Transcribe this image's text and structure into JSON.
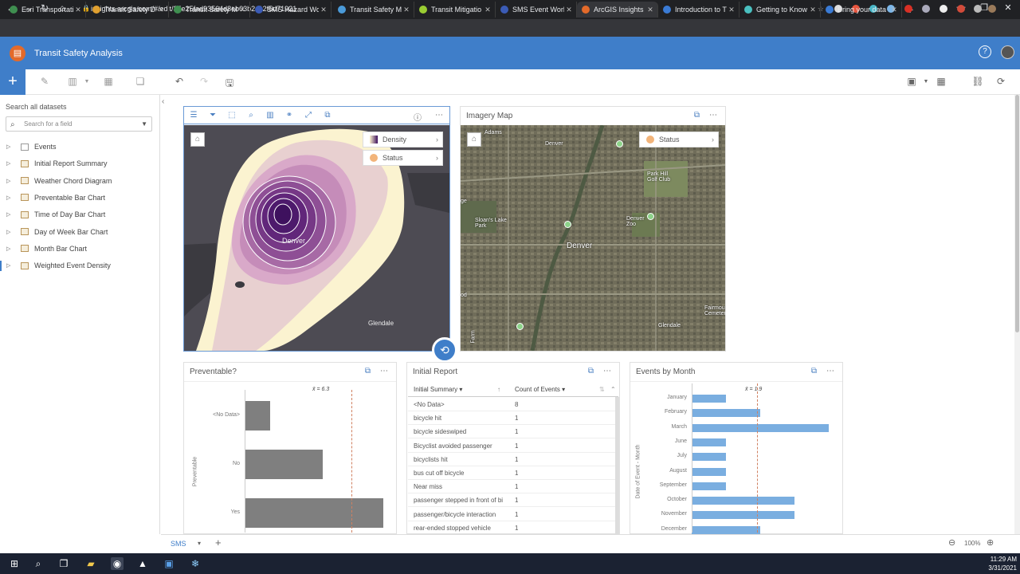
{
  "browser": {
    "tabs": [
      {
        "title": "Esri Transportatio",
        "color": "#3f8f50"
      },
      {
        "title": "Transit Safety Da",
        "color": "#e0a030"
      },
      {
        "title": "Transit Safety Ma",
        "color": "#3f8f50"
      },
      {
        "title": "SMS Hazard Wor",
        "color": "#3b5bb5"
      },
      {
        "title": "Transit Safety Ma",
        "color": "#4a9ad8"
      },
      {
        "title": "Transit Mitigatio",
        "color": "#9acd32"
      },
      {
        "title": "SMS Event Work",
        "color": "#3b5bb5"
      },
      {
        "title": "ArcGIS Insights",
        "color": "#e36a2a"
      },
      {
        "title": "Introduction to T",
        "color": "#3a7bd5"
      },
      {
        "title": "Getting to Know",
        "color": "#4ac0c0"
      },
      {
        "title": "Bring your data",
        "color": "#3a7bd5"
      }
    ],
    "url": "insights.arcgis.com/#/edit/35e25fad93564d8eb03b2c12f5d71921"
  },
  "app": {
    "title": "Transit Safety Analysis"
  },
  "left_panel": {
    "search_label": "Search all datasets",
    "field_placeholder": "Search for a field",
    "datasets": [
      {
        "label": "Events"
      },
      {
        "label": "Initial Report Summary"
      },
      {
        "label": "Weather Chord Diagram"
      },
      {
        "label": "Preventable Bar Chart"
      },
      {
        "label": "Time of Day Bar Chart"
      },
      {
        "label": "Day of Week Bar Chart"
      },
      {
        "label": "Month Bar Chart"
      },
      {
        "label": "Weighted Event Density"
      }
    ]
  },
  "density_map": {
    "legend_density": "Density",
    "legend_status": "Status",
    "label_denver": "Denver",
    "label_glendale": "Glendale"
  },
  "imagery_map": {
    "title": "Imagery Map",
    "legend_status": "Status",
    "labels": {
      "denver_big": "Denver",
      "denver_top": "Denver",
      "adams": "Adams",
      "park_hill": "Park Hill Golf Club",
      "sloans": "Sloan's Lake Park",
      "denver_zoo": "Denver Zoo",
      "glendale": "Glendale",
      "fairmount": "Fairmount Cemetery",
      "od": "od",
      "ge": "ge",
      "farm": "Farm"
    }
  },
  "preventable": {
    "title": "Preventable?",
    "mean_label": "x̄ = 6.3",
    "ylabel": "Preventable",
    "chart_data": {
      "type": "bar",
      "categories": [
        "<No Data>",
        "No",
        "Yes"
      ],
      "values": [
        1.5,
        4.6,
        8.2
      ],
      "xlim": [
        0,
        8.2
      ],
      "mean": 6.3
    }
  },
  "initial_report": {
    "title": "Initial Report",
    "col1": "Initial Summary",
    "col2": "Count of Events",
    "rows": [
      {
        "summary": "<No Data>",
        "count": "8"
      },
      {
        "summary": "bicycle hit",
        "count": "1"
      },
      {
        "summary": "bicycle sideswiped",
        "count": "1"
      },
      {
        "summary": "Bicyclist avoided passenger",
        "count": "1"
      },
      {
        "summary": "bicyclists hit",
        "count": "1"
      },
      {
        "summary": "bus cut off bicycle",
        "count": "1"
      },
      {
        "summary": "Near miss",
        "count": "1"
      },
      {
        "summary": "passenger stepped in front of bi",
        "count": "1"
      },
      {
        "summary": "passenger/bicycle interaction",
        "count": "1"
      },
      {
        "summary": "rear-ended stopped vehicle",
        "count": "1"
      }
    ]
  },
  "events_by_month": {
    "title": "Events by Month",
    "mean_label": "x̄ = 1.9",
    "ylabel": "Date of Event - Month",
    "chart_data": {
      "type": "bar",
      "categories": [
        "January",
        "February",
        "March",
        "June",
        "July",
        "August",
        "September",
        "October",
        "November",
        "December"
      ],
      "values": [
        1,
        2,
        4,
        1,
        1,
        1,
        1,
        3,
        3,
        2
      ],
      "xlim": [
        0,
        4
      ],
      "mean": 1.9
    }
  },
  "sheet": {
    "tab": "SMS",
    "zoom": "100%"
  },
  "taskbar": {
    "time": "11:29 AM",
    "date": "3/31/2021"
  }
}
